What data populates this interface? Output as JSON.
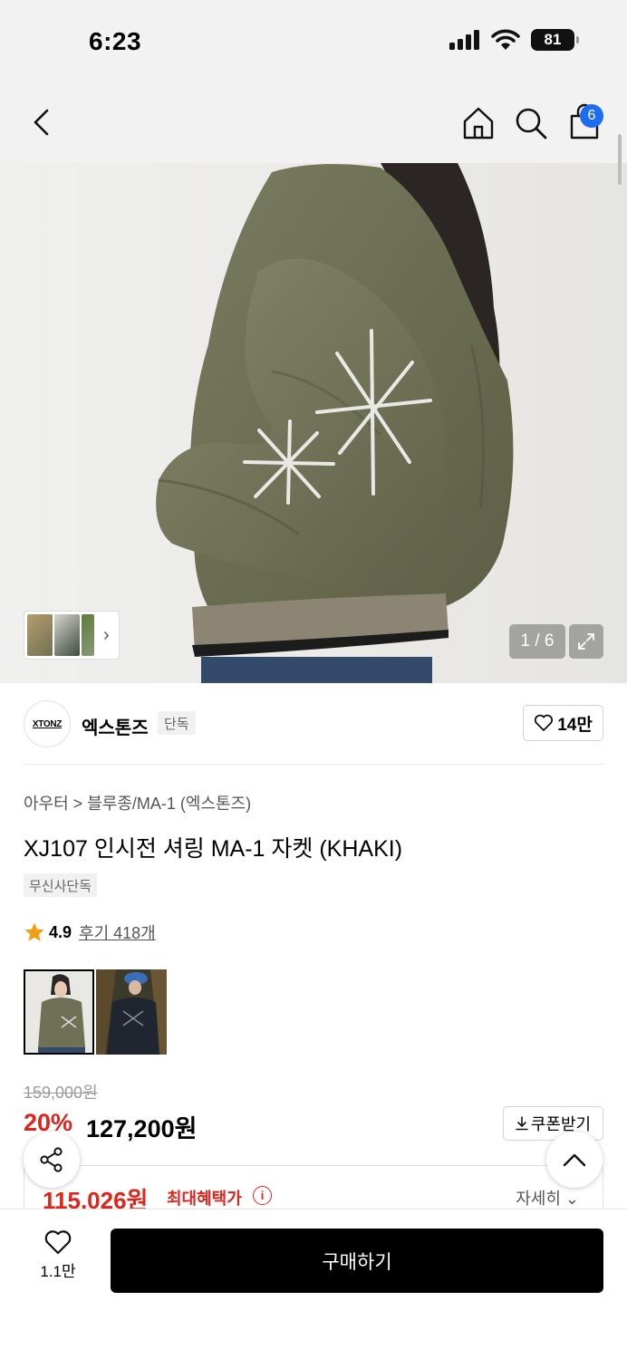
{
  "status_bar": {
    "time": "6:23",
    "battery": "81"
  },
  "nav": {
    "cart_count": "6"
  },
  "gallery": {
    "counter": "1 / 6"
  },
  "brand": {
    "logo_text": "XTONZ",
    "name": "엑스톤즈",
    "tag": "단독",
    "likes": "14만"
  },
  "product": {
    "breadcrumb": "아우터 > 블루종/MA-1 (엑스톤즈)",
    "title": "XJ107 인시전 셔링 MA-1 자켓 (KHAKI)",
    "exclusive_badge": "무신사단독",
    "rating": "4.9",
    "review_text": "후기 418개"
  },
  "price": {
    "original": "159,000원",
    "discount": "20%",
    "sale": "127,200원",
    "coupon_label": "쿠폰받기",
    "best_price": "115,026원",
    "best_label": "최대혜택가",
    "detail_label": "자세히"
  },
  "bottom": {
    "wish_count": "1.1만",
    "buy_label": "구매하기"
  },
  "colors": {
    "accent_red": "#e0241b",
    "badge_blue": "#1e6cf2",
    "jacket_khaki": "#6f7156"
  }
}
